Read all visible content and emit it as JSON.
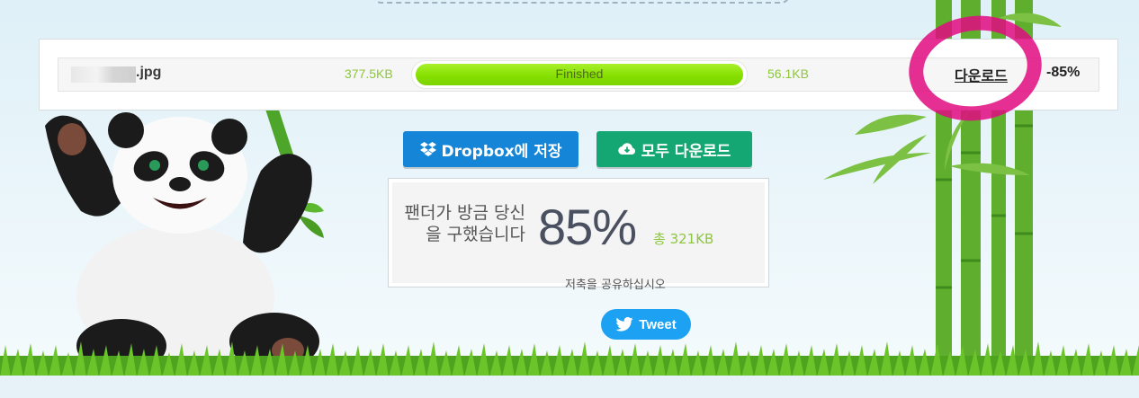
{
  "file": {
    "name_ext": ".jpg",
    "original_size": "377.5KB",
    "status_label": "Finished",
    "progress_fraction": 1.0,
    "compressed_size": "56.1KB",
    "download_label": "다운로드",
    "savings": "-85%"
  },
  "actions": {
    "dropbox_label": "Dropbox에 저장",
    "download_all_label": "모두 다운로드"
  },
  "stats": {
    "message": "팬더가 방금 당신을 구했습니다",
    "percent": "85%",
    "total": "총 321KB"
  },
  "share": {
    "text": "저축을 공유하십시오",
    "tweet_label": "Tweet"
  },
  "colors": {
    "accent_green": "#8dc63f",
    "progress_green": "#86e000",
    "dropbox_blue": "#1585d8",
    "download_green": "#14a773",
    "twitter_blue": "#1da1f2",
    "highlight_pink": "#e20b80"
  },
  "icons": {
    "dropbox": "dropbox-icon",
    "cloud_download": "cloud-download-icon",
    "twitter": "twitter-bird-icon"
  }
}
